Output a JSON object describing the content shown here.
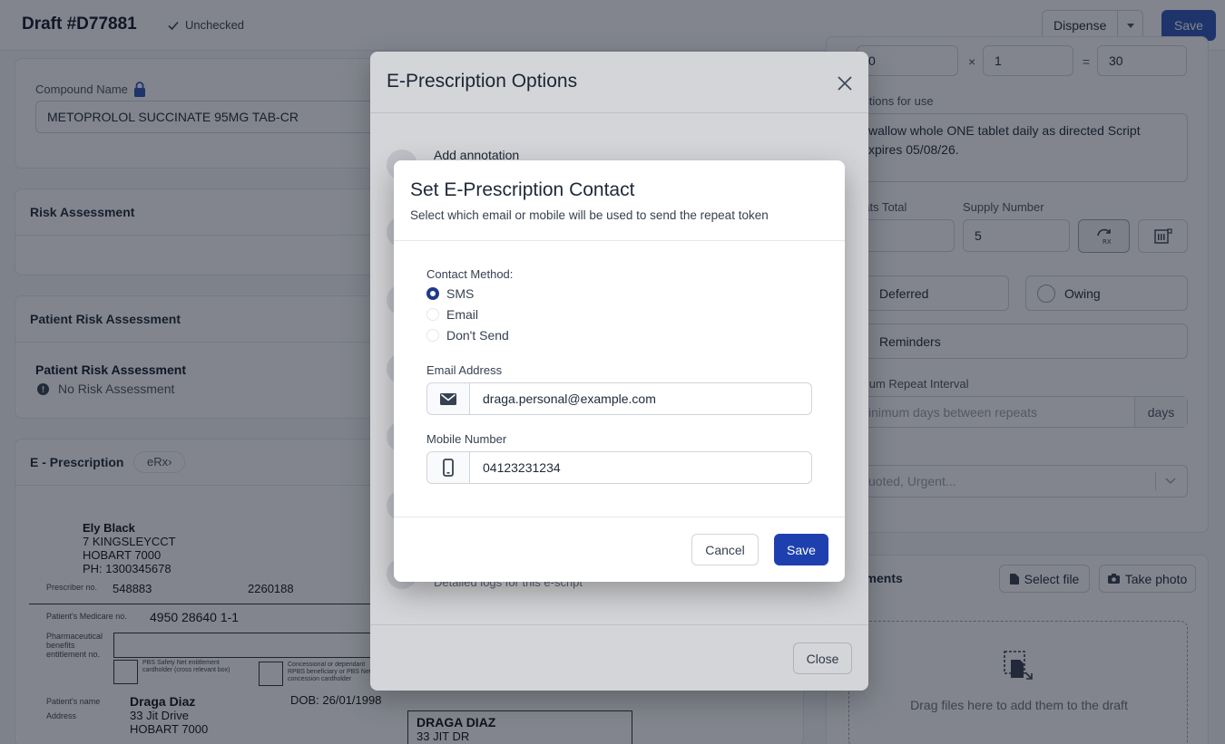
{
  "header": {
    "title": "Draft #D77881",
    "status": "Unchecked",
    "dispense_label": "Dispense",
    "save_label": "Save"
  },
  "left": {
    "compound": {
      "label": "Compound Name",
      "value": "METOPROLOL SUCCINATE 95MG TAB-CR"
    },
    "risk_assessment": {
      "title": "Risk Assessment"
    },
    "patient_risk": {
      "title": "Patient Risk Assessment",
      "subtitle": "Patient Risk Assessment",
      "status": "No Risk Assessment"
    },
    "eprescription": {
      "title": "E - Prescription",
      "badge": "eRx"
    }
  },
  "script": {
    "prescriber_name": "Ely Black",
    "prescriber_street": "7 KINGSLEYCCT",
    "prescriber_city": "HOBART 7000",
    "prescriber_phone": "PH: 1300345678",
    "prescriber_no_label": "Prescriber no.",
    "prescriber_no": "548883",
    "prescriber_no_2": "2260188",
    "medicare_label": "Patient's Medicare no.",
    "medicare_no": "4950 28640 1-1",
    "pbs_label": "Pharmaceutical benefits entitlement no.",
    "safety_net_label": "PBS Safety Net entitlement cardholder (cross relevant box)",
    "concession_label": "Concessional or dependant RPBS beneficiary or PBS Net concession cardholder",
    "patient_name_label": "Patient's name",
    "address_label": "Address",
    "patient_name": "Draga Diaz",
    "dob": "DOB: 26/01/1998",
    "patient_street": "33 Jit Drive",
    "patient_city": "HOBART 7000",
    "stub_name": "DRAGA DIAZ",
    "stub_street": "33 JIT DR"
  },
  "right": {
    "qty_a": "0",
    "times": "×",
    "qty_b": "1",
    "equals": "=",
    "qty_total": "30",
    "directions_label": "ections for use",
    "directions": "wallow whole ONE tablet daily as directed Script xpires 05/08/26.",
    "repeats_label": "eats Total",
    "supply_label": "Supply Number",
    "supply_value": "5",
    "deferred": "Deferred",
    "owing": "Owing",
    "reminders": "Reminders",
    "interval_label": "imum Repeat Interval",
    "interval_placeholder": "inimum days between repeats",
    "interval_unit": "days",
    "tags_label": "s",
    "tags_placeholder": "uoted, Urgent...",
    "documents_label": "uments",
    "select_file": "Select file",
    "take_photo": "Take photo",
    "drop_text": "Drag files here to add them to the draft"
  },
  "options_modal": {
    "title": "E-Prescription Options",
    "first_option": "Add annotation",
    "last_option_desc": "Detailed logs for this e-script",
    "close_label": "Close"
  },
  "contact_modal": {
    "title": "Set E-Prescription Contact",
    "subtitle": "Select which email or mobile will be used to send the repeat token",
    "method_label": "Contact Method:",
    "methods": [
      {
        "label": "SMS",
        "selected": true
      },
      {
        "label": "Email",
        "selected": false
      },
      {
        "label": "Don't Send",
        "selected": false
      }
    ],
    "email_label": "Email Address",
    "email_value": "draga.personal@example.com",
    "mobile_label": "Mobile Number",
    "mobile_value": "04123231234",
    "cancel_label": "Cancel",
    "save_label": "Save",
    "accent_color": "#1e40af"
  }
}
